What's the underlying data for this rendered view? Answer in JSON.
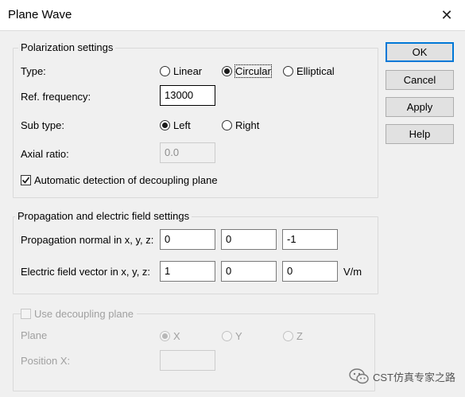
{
  "window": {
    "title": "Plane Wave",
    "close_symbol": "✕"
  },
  "polarization": {
    "title": "Polarization settings",
    "type_label": "Type:",
    "type_options": [
      {
        "label": "Linear",
        "selected": false
      },
      {
        "label": "Circular",
        "selected": true
      },
      {
        "label": "Elliptical",
        "selected": false
      }
    ],
    "ref_freq_label": "Ref. frequency:",
    "ref_freq_value": "13000",
    "subtype_label": "Sub type:",
    "subtype_options": [
      {
        "label": "Left",
        "selected": true
      },
      {
        "label": "Right",
        "selected": false
      }
    ],
    "axial_ratio_label": "Axial ratio:",
    "axial_ratio_value": "0.0",
    "auto_detect_label": "Automatic detection of decoupling plane",
    "auto_detect_checked": true
  },
  "propagation": {
    "title": "Propagation and electric field settings",
    "normal_label": "Propagation normal in x, y, z:",
    "normal_values": [
      "0",
      "0",
      "-1"
    ],
    "efield_label": "Electric field vector in x, y, z:",
    "efield_values": [
      "1",
      "0",
      "0"
    ],
    "unit": "V/m"
  },
  "decoupling": {
    "checkbox_label": "Use decoupling plane",
    "checked": false,
    "plane_label": "Plane",
    "plane_options": [
      {
        "label": "X",
        "selected": true
      },
      {
        "label": "Y",
        "selected": false
      },
      {
        "label": "Z",
        "selected": false
      }
    ],
    "position_label": "Position X:",
    "position_value": ""
  },
  "buttons": {
    "ok": "OK",
    "cancel": "Cancel",
    "apply": "Apply",
    "help": "Help"
  },
  "watermark": {
    "text": "CST仿真专家之路",
    "icon": "wechat-icon"
  },
  "colors": {
    "default_button_border": "#0078d7",
    "background": "#f0f0f0"
  }
}
